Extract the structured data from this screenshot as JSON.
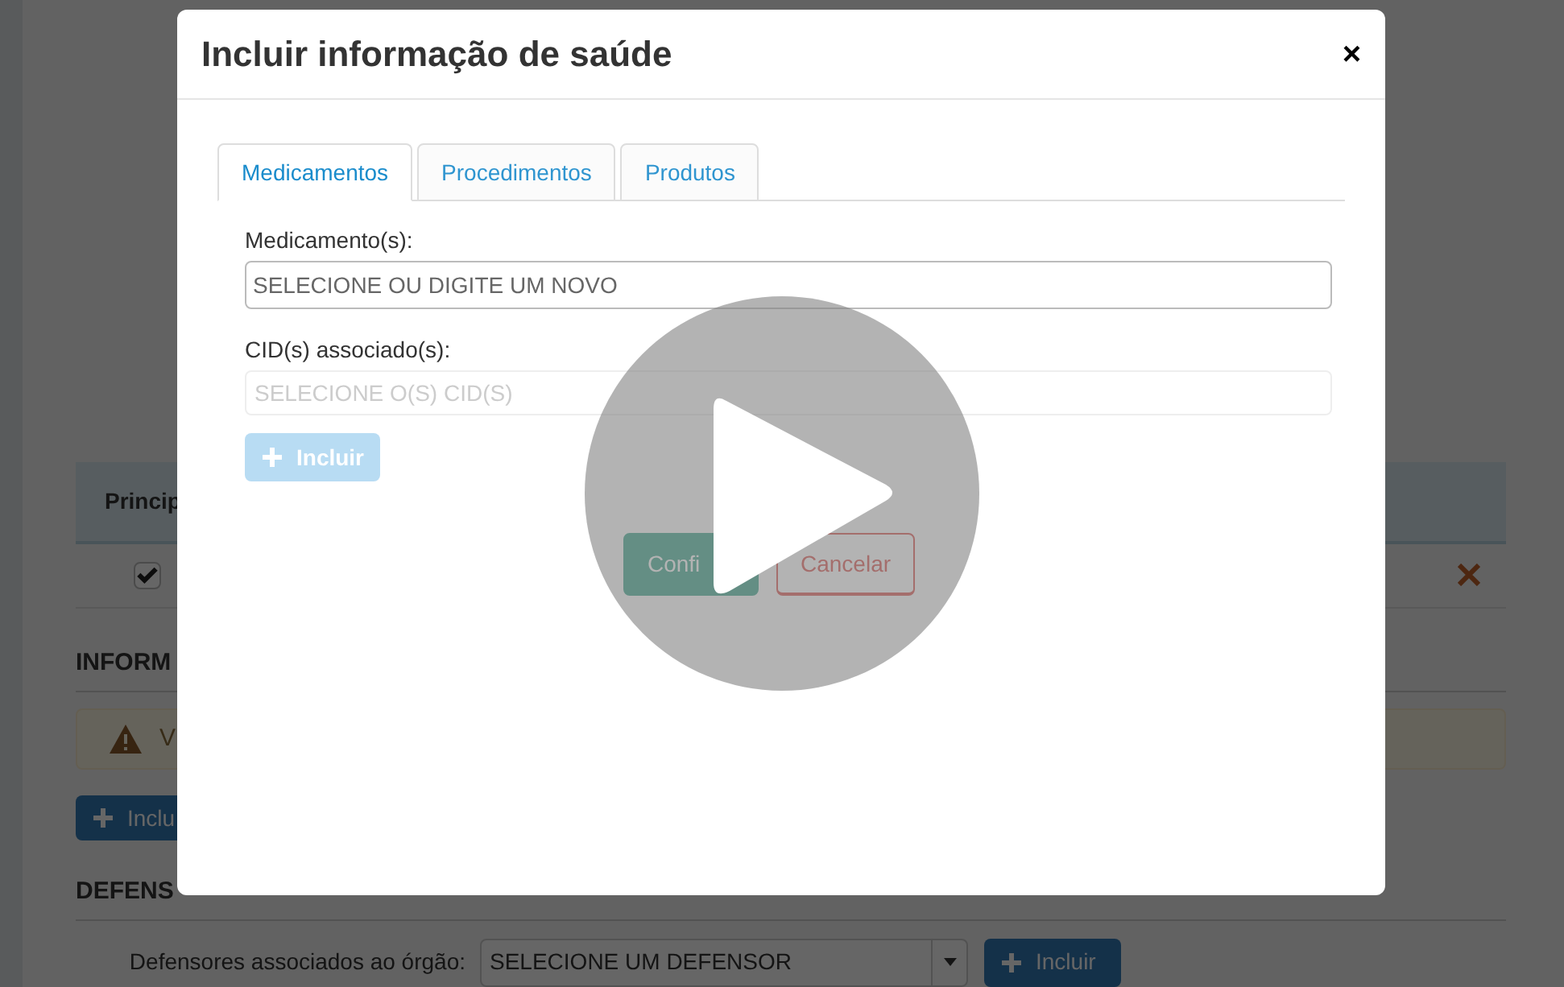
{
  "background": {
    "table": {
      "column_1": "Princip",
      "rows": [
        {
          "checked": true
        }
      ]
    },
    "sections": [
      {
        "title": "INFORM",
        "alert": "V",
        "button": "Inclu"
      },
      {
        "title": "DEFENS"
      }
    ],
    "defensor": {
      "label": "Defensores associados ao órgão:",
      "value": "SELECIONE UM DEFENSOR",
      "button": "Incluir"
    }
  },
  "modal": {
    "title": "Incluir informação de saúde",
    "close": "×",
    "tabs": [
      {
        "label": "Medicamentos",
        "selected": true
      },
      {
        "label": "Procedimentos",
        "selected": false
      },
      {
        "label": "Produtos",
        "selected": false
      }
    ],
    "fields": [
      {
        "label": "Medicamento(s):",
        "placeholder": "SELECIONE OU DIGITE UM NOVO",
        "disabled": false
      },
      {
        "label": "CID(s) associado(s):",
        "placeholder": "SELECIONE O(S) CID(S)",
        "disabled": true
      }
    ],
    "add_button": {
      "label": "Incluir",
      "disabled": true
    },
    "buttons": [
      {
        "label": "Confi",
        "kind": "confirm"
      },
      {
        "label": "Cancelar",
        "kind": "cancel"
      }
    ]
  }
}
